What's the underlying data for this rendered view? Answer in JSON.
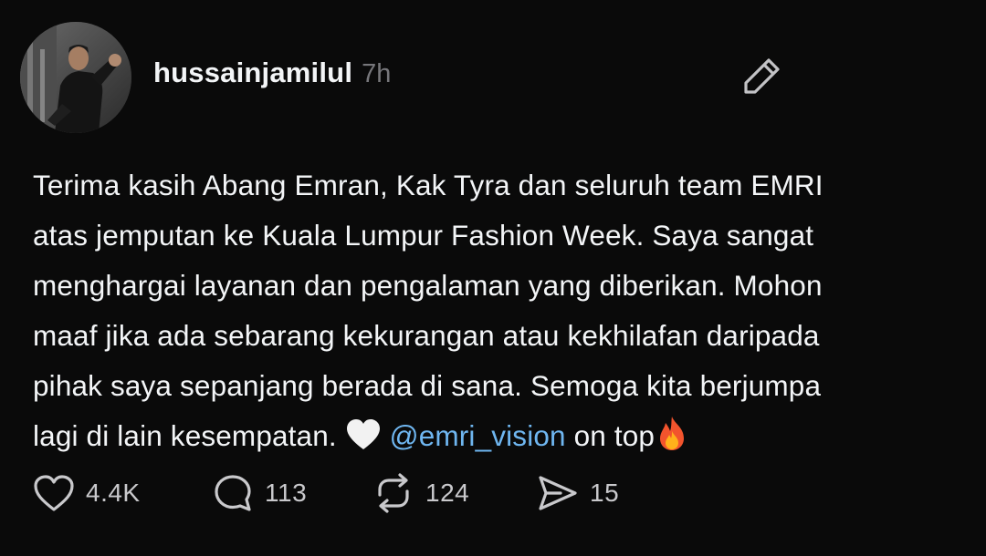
{
  "post": {
    "author": {
      "username": "hussainjamilul",
      "time_ago": "7h",
      "avatar_icon": "profile-photo"
    },
    "edit_icon": "pencil-icon",
    "text": {
      "line1": "Terima kasih Abang Emran, Kak Tyra dan seluruh team EMRI",
      "line2": "atas jemputan ke Kuala Lumpur Fashion Week. Saya sangat",
      "line3": "menghargai layanan dan pengalaman yang diberikan. Mohon",
      "line4": "maaf jika ada sebarang kekurangan atau kekhilafan daripada",
      "line5": "pihak saya sepanjang berada di sana. Semoga kita berjumpa",
      "line6_before": "lagi di lain kesempatan. ",
      "heart_emoji": "🤍",
      "mention": "@emri_vision",
      "line6_after": " on top",
      "fire_emoji": "🔥"
    },
    "actions": {
      "likes": "4.4K",
      "comments": "113",
      "reposts": "124",
      "shares": "15"
    }
  },
  "colors": {
    "background": "#0a0a0a",
    "text": "#f3f5f7",
    "muted": "#77777b",
    "mention": "#6fb6f0"
  }
}
